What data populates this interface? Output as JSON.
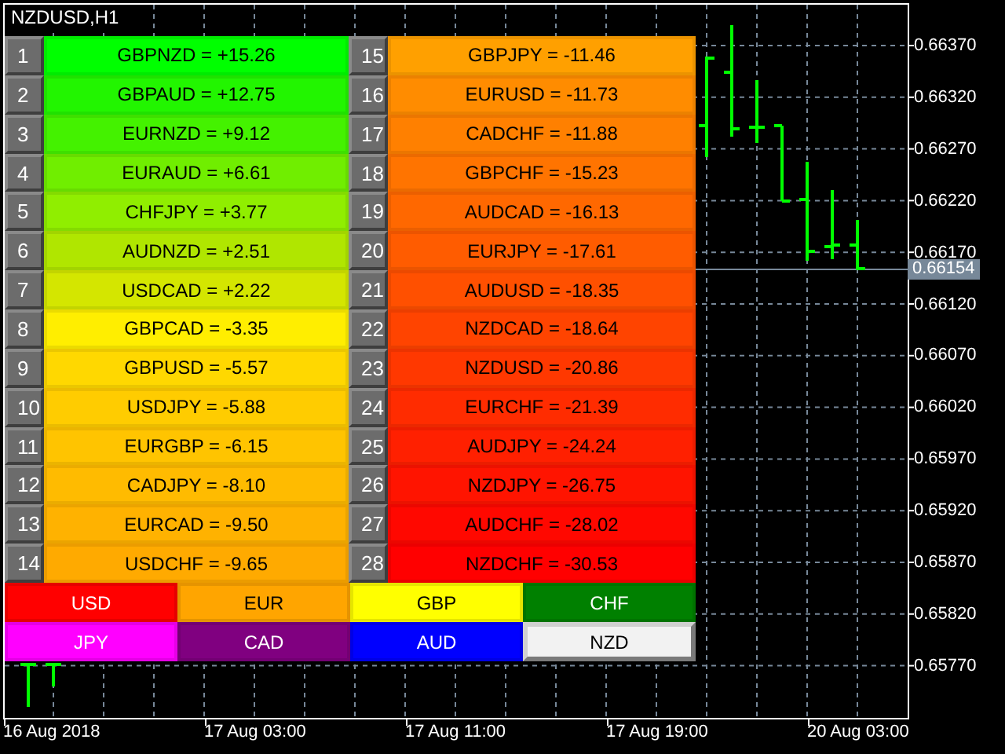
{
  "chart": {
    "title": "NZDUSD,H1",
    "price_labels": [
      "0.66370",
      "0.66320",
      "0.66270",
      "0.66220",
      "0.66170",
      "0.66120",
      "0.66070",
      "0.66020",
      "0.65970",
      "0.65920",
      "0.65870",
      "0.65820",
      "0.65770"
    ],
    "current_price": "0.66154",
    "time_labels": [
      "16 Aug 2018",
      "17 Aug 03:00",
      "17 Aug 11:00",
      "17 Aug 19:00",
      "20 Aug 03:00"
    ]
  },
  "strength_table": {
    "rows": [
      {
        "rank": "1",
        "pair": "GBPNZD = +15.26",
        "color": "#00ff00"
      },
      {
        "rank": "2",
        "pair": "GBPAUD = +12.75",
        "color": "#22f500"
      },
      {
        "rank": "3",
        "pair": "EURNZD = +9.12",
        "color": "#44f200"
      },
      {
        "rank": "4",
        "pair": "EURAUD = +6.61",
        "color": "#70ee00"
      },
      {
        "rank": "5",
        "pair": "CHFJPY = +3.77",
        "color": "#90ee00"
      },
      {
        "rank": "6",
        "pair": "AUDNZD = +2.51",
        "color": "#b0e600"
      },
      {
        "rank": "7",
        "pair": "USDCAD = +2.22",
        "color": "#d4e600"
      },
      {
        "rank": "8",
        "pair": "GBPCAD = -3.35",
        "color": "#ffee00"
      },
      {
        "rank": "9",
        "pair": "GBPUSD = -5.57",
        "color": "#ffd800"
      },
      {
        "rank": "10",
        "pair": "USDJPY = -5.88",
        "color": "#ffcc00"
      },
      {
        "rank": "11",
        "pair": "EURGBP = -6.15",
        "color": "#ffc400"
      },
      {
        "rank": "12",
        "pair": "CADJPY = -8.10",
        "color": "#ffbb00"
      },
      {
        "rank": "13",
        "pair": "EURCAD = -9.50",
        "color": "#ffb200"
      },
      {
        "rank": "14",
        "pair": "USDCHF = -9.65",
        "color": "#ffaa00"
      },
      {
        "rank": "15",
        "pair": "GBPJPY = -11.46",
        "color": "#ffa000"
      },
      {
        "rank": "16",
        "pair": "EURUSD = -11.73",
        "color": "#ff8c00"
      },
      {
        "rank": "17",
        "pair": "CADCHF = -11.88",
        "color": "#ff8000"
      },
      {
        "rank": "18",
        "pair": "GBPCHF = -15.23",
        "color": "#ff7400"
      },
      {
        "rank": "19",
        "pair": "AUDCAD = -16.13",
        "color": "#ff6800"
      },
      {
        "rank": "20",
        "pair": "EURJPY = -17.61",
        "color": "#ff5c00"
      },
      {
        "rank": "21",
        "pair": "AUDUSD = -18.35",
        "color": "#ff5000"
      },
      {
        "rank": "22",
        "pair": "NZDCAD = -18.64",
        "color": "#ff4400"
      },
      {
        "rank": "23",
        "pair": "NZDUSD = -20.86",
        "color": "#ff3800"
      },
      {
        "rank": "24",
        "pair": "EURCHF = -21.39",
        "color": "#ff2c00"
      },
      {
        "rank": "25",
        "pair": "AUDJPY = -24.24",
        "color": "#ff2000"
      },
      {
        "rank": "26",
        "pair": "NZDJPY = -26.75",
        "color": "#ff1400"
      },
      {
        "rank": "27",
        "pair": "AUDCHF = -28.02",
        "color": "#ff0800"
      },
      {
        "rank": "28",
        "pair": "NZDCHF = -30.53",
        "color": "#ff0000"
      }
    ]
  },
  "currency_buttons": [
    {
      "label": "USD",
      "color": "#ff0000",
      "selected": false
    },
    {
      "label": "EUR",
      "color": "#ffa500",
      "selected": false
    },
    {
      "label": "GBP",
      "color": "#ffff00",
      "selected": false
    },
    {
      "label": "CHF",
      "color": "#008000",
      "selected": false
    },
    {
      "label": "JPY",
      "color": "#ff00ff",
      "selected": false
    },
    {
      "label": "CAD",
      "color": "#800080",
      "selected": false
    },
    {
      "label": "AUD",
      "color": "#0000ff",
      "selected": false
    },
    {
      "label": "NZD",
      "color": "#f2f2f2",
      "selected": true
    }
  ]
}
